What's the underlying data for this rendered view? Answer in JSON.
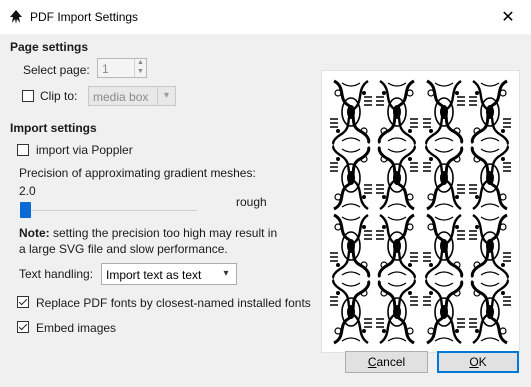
{
  "window": {
    "title": "PDF Import Settings",
    "app_icon": "inkscape-icon",
    "close_glyph": "✕"
  },
  "page_settings": {
    "heading": "Page settings",
    "select_page_label": "Select page:",
    "select_page_value": "1",
    "clip_to_label": "Clip to:",
    "clip_to_checked": false,
    "clip_to_value": "media box"
  },
  "import_settings": {
    "heading": "Import settings",
    "poppler_label": "import via Poppler",
    "poppler_checked": false,
    "precision_label": "Precision of approximating gradient meshes:",
    "precision_value": "2.0",
    "precision_hint": "rough",
    "note_bold": "Note:",
    "note_line1": " setting the precision too high may result in",
    "note_line2": "a large SVG file and slow performance.",
    "text_handling_label": "Text handling:",
    "text_handling_value": "Import text as text",
    "replace_fonts_label": "Replace PDF fonts by closest-named installed fonts",
    "replace_fonts_checked": true,
    "embed_images_label": "Embed images",
    "embed_images_checked": true
  },
  "buttons": {
    "cancel_first": "C",
    "cancel_rest": "ancel",
    "ok_first": "O",
    "ok_rest": "K"
  },
  "colors": {
    "accent": "#0078d7",
    "slider": "#0b6bd4",
    "client_bg": "#f0f0f0"
  }
}
